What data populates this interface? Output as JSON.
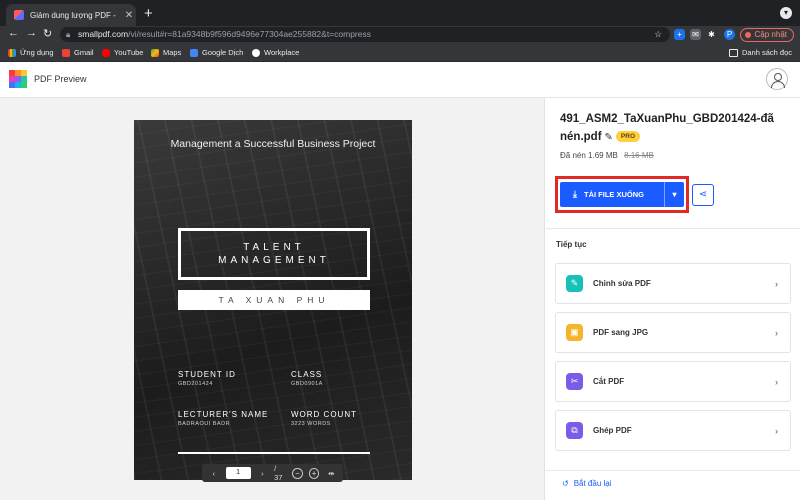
{
  "browser": {
    "tab_title": "Giảm dung lượng PDF - Giảm F",
    "url_host": "smallpdf.com",
    "url_path": "/vi/result#r=81a9348b9f596d9496e77304ae255882&t=compress",
    "update_label": "Cập nhật",
    "bookmarks": [
      "Ứng dụng",
      "Gmail",
      "YouTube",
      "Maps",
      "Google Dịch",
      "Workplace"
    ],
    "reading_list": "Danh sách đọc",
    "profile_initial": "P"
  },
  "app": {
    "title": "PDF Preview"
  },
  "document": {
    "heading": "Management a Successful Business Project",
    "talent_line1": "TALENT",
    "talent_line2": "MANAGEMENT",
    "student_name": "TA XUAN PHU",
    "fields": [
      {
        "label": "STUDENT ID",
        "value": "GBD201424"
      },
      {
        "label": "CLASS",
        "value": "GBD0901A"
      },
      {
        "label": "LECTURER'S NAME",
        "value": "BADRAOUI BADR"
      },
      {
        "label": "WORD COUNT",
        "value": "3223 WORDS"
      }
    ]
  },
  "pager": {
    "current": "1",
    "total": "/ 37"
  },
  "file": {
    "name": "491_ASM2_TaXuanPhu_GBD201424-đã nén.pdf",
    "badge": "PRO",
    "compressed_label": "Đã nén",
    "new_size": "1.69 MB",
    "old_size": "8.16 MB"
  },
  "download": {
    "label": "TẢI FILE XUỐNG"
  },
  "continue_label": "Tiếp tục",
  "tools": [
    {
      "label": "Chỉnh sửa PDF",
      "color": "#17c1b8"
    },
    {
      "label": "PDF sang JPG",
      "color": "#f5b52a"
    },
    {
      "label": "Cắt PDF",
      "color": "#7b5ce6"
    },
    {
      "label": "Ghép PDF",
      "color": "#7b5ce6"
    }
  ],
  "restart_label": "Bắt đầu lại"
}
